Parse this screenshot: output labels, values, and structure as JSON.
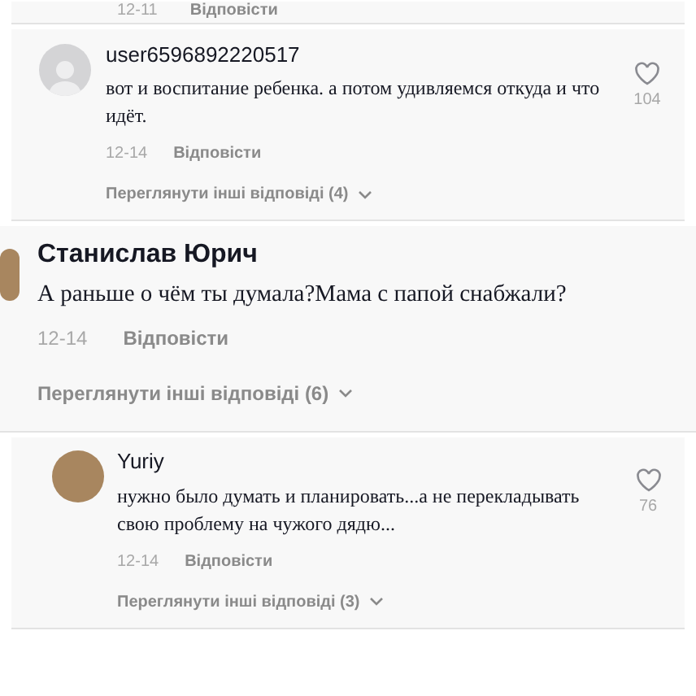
{
  "previous_reply": {
    "date": "12-11",
    "reply": "Відповісти"
  },
  "comments": [
    {
      "kind": "default",
      "author": "user6596892220517",
      "text": "вот и воспитание ребенка. а потом удивляемся откуда и что идёт.",
      "likes": "104",
      "date": "12-14",
      "reply": "Відповісти",
      "more_replies": "Переглянути інші відповіді (4)"
    },
    {
      "kind": "photo",
      "author": "Станислав Юрич",
      "text": "А раньше о чём ты думала?Мама с папой снабжали?",
      "date": "12-14",
      "reply": "Відповісти",
      "more_replies": "Переглянути інші відповіді (6)"
    },
    {
      "kind": "photo",
      "author": "Yuriy",
      "text": "нужно было думать и планировать...а не перекладывать свою проблему на чужого дядю...",
      "likes": "76",
      "date": "12-14",
      "reply": "Відповісти",
      "more_replies": "Переглянути інші відповіді (3)"
    }
  ]
}
